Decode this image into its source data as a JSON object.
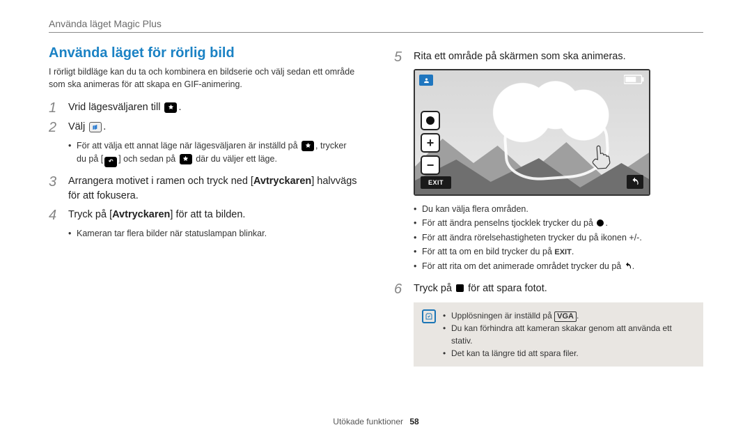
{
  "breadcrumb": "Använda läget Magic Plus",
  "heading": "Använda läget för rörlig bild",
  "intro": "I rörligt bildläge kan du ta och kombinera en bildserie och välj sedan ett område som ska animeras för att skapa en GIF-animering.",
  "left_steps": {
    "s1": {
      "num": "1",
      "body_pre": "Vrid lägesväljaren till ",
      "body_post": "."
    },
    "s2": {
      "num": "2",
      "body_pre": "Välj ",
      "body_post": "."
    },
    "s2_sub_a": "För att välja ett annat läge när lägesväljaren är inställd på ",
    "s2_sub_b": ", trycker du på [",
    "s2_sub_c": "] och sedan på ",
    "s2_sub_d": " där du väljer ett läge.",
    "s3": {
      "num": "3",
      "body_pre": "Arrangera motivet i ramen och tryck ned [",
      "bold": "Avtryckaren",
      "body_post": "] halvvägs för att fokusera."
    },
    "s4": {
      "num": "4",
      "body_pre": "Tryck på [",
      "bold": "Avtryckaren",
      "body_post": "] för att ta bilden."
    },
    "s4_sub": "Kameran tar flera bilder när statuslampan blinkar."
  },
  "right_steps": {
    "s5": {
      "num": "5",
      "body": "Rita ett område på skärmen som ska animeras."
    },
    "exit_label": "EXIT",
    "bullets5": [
      "Du kan välja flera områden.",
      {
        "pre": "För att ändra penselns tjocklek trycker du på ",
        "suffix": "."
      },
      {
        "pre": "För att ändra rörelsehastigheten trycker du på ikonen +/-."
      },
      {
        "pre": "För att ta om en bild trycker du på ",
        "exit": " ."
      },
      {
        "pre": "För att rita om det animerade området trycker du på ",
        "undo": true,
        "suffix": "."
      }
    ],
    "s6": {
      "num": "6",
      "body_pre": "Tryck på ",
      "body_post": " för att spara fotot."
    }
  },
  "callout": {
    "l1_pre": "Upplösningen är inställd på ",
    "l1_vga": "VGA",
    "l1_post": ".",
    "l2": "Du kan förhindra att kameran skakar genom att använda ett stativ.",
    "l3": "Det kan ta längre tid att spara filer."
  },
  "footer": {
    "section": "Utökade funktioner",
    "page": "58"
  }
}
